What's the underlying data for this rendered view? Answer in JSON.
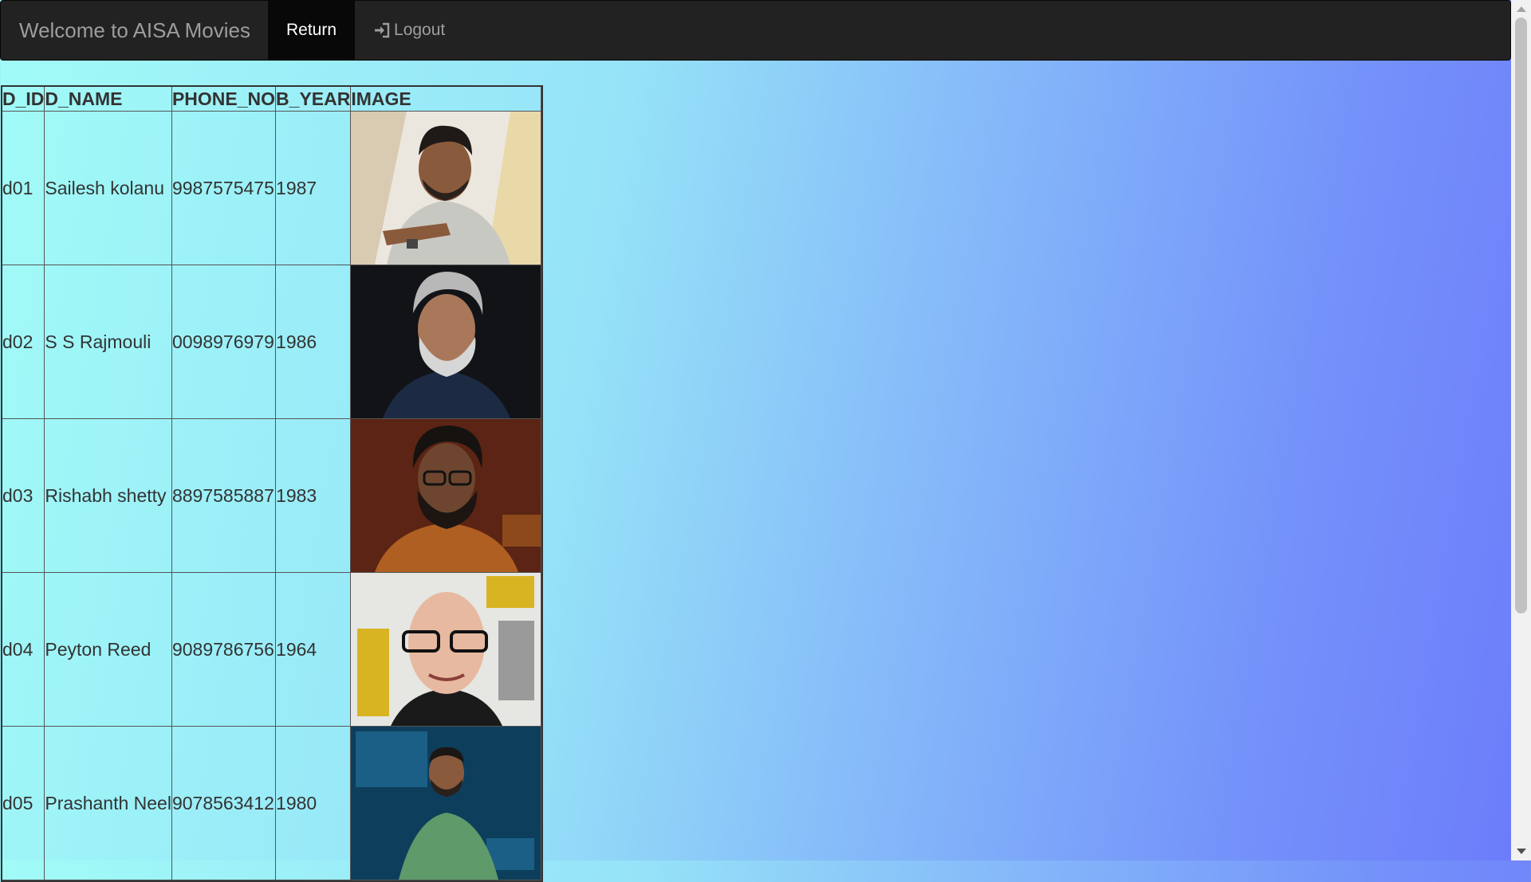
{
  "navbar": {
    "brand": "Welcome to AISA Movies",
    "return_label": "Return",
    "logout_label": "Logout",
    "logout_icon": "log-in-icon"
  },
  "table": {
    "headers": [
      "D_ID",
      "D_NAME",
      "PHONE_NO",
      "B_YEAR",
      "IMAGE"
    ],
    "rows": [
      {
        "id": "d01",
        "name": "Sailesh kolanu",
        "phone": "9987575475",
        "year": "1987"
      },
      {
        "id": "d02",
        "name": "S S Rajmouli",
        "phone": "0098976979",
        "year": "1986"
      },
      {
        "id": "d03",
        "name": "Rishabh shetty",
        "phone": "8897585887",
        "year": "1983"
      },
      {
        "id": "d04",
        "name": "Peyton Reed",
        "phone": "9089786756",
        "year": "1964"
      },
      {
        "id": "d05",
        "name": "Prashanth Neel",
        "phone": "9078563412",
        "year": "1980"
      }
    ]
  },
  "colors": {
    "navbar_bg": "#222222",
    "navbar_active_bg": "#080808",
    "gradient_start": "#a1fbf7",
    "gradient_end": "#6c7bfa"
  }
}
